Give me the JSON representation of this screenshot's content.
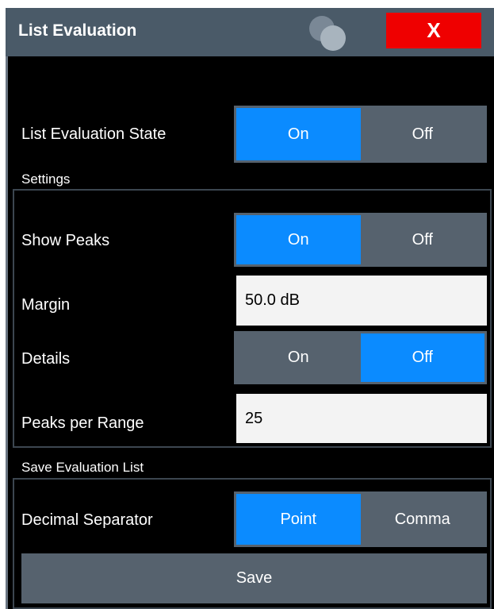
{
  "dialog": {
    "title": "List Evaluation",
    "close_label": "X",
    "docs_icon": "overlapping-circles-icon"
  },
  "list_evaluation_state": {
    "label": "List Evaluation State",
    "options": [
      "On",
      "Off"
    ],
    "selected": "On"
  },
  "settings": {
    "section_label": "Settings",
    "show_peaks": {
      "label": "Show Peaks",
      "options": [
        "On",
        "Off"
      ],
      "selected": "On"
    },
    "margin": {
      "label": "Margin",
      "value": "50.0 dB"
    },
    "details": {
      "label": "Details",
      "options": [
        "On",
        "Off"
      ],
      "selected": "Off"
    },
    "peaks_per_range": {
      "label": "Peaks per Range",
      "value": "25"
    }
  },
  "save_evaluation_list": {
    "section_label": "Save Evaluation List",
    "decimal_separator": {
      "label": "Decimal Separator",
      "options": [
        "Point",
        "Comma"
      ],
      "selected": "Point"
    },
    "save_label": "Save"
  },
  "colors": {
    "title_bar": "#4a5a68",
    "close_button": "#ef0000",
    "selected_option": "#0b8bff",
    "toggle_background": "#56626e",
    "field_background": "#f3f3f3",
    "dialog_background": "#000000"
  }
}
